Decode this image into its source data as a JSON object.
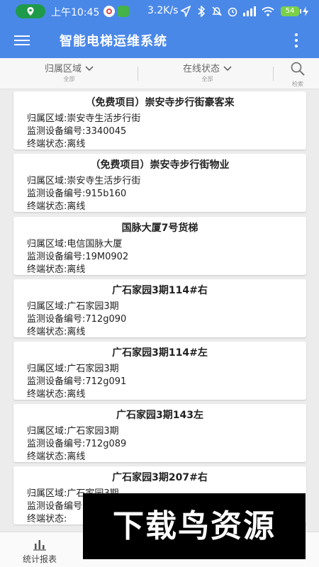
{
  "status_bar": {
    "time": "上午10:45",
    "net_speed": "3.2K/s",
    "battery": "54"
  },
  "app": {
    "title": "智能电梯运维系统"
  },
  "filters": [
    {
      "label": "归属区域",
      "sub": "全部"
    },
    {
      "label": "在线状态",
      "sub": "全部"
    }
  ],
  "search": {
    "sub": "检索"
  },
  "cards": [
    {
      "title": "（免费项目）崇安寺步行街豪客来",
      "area": "归属区域:崇安寺生活步行街",
      "device": "监测设备编号:3340045",
      "status": "终端状态:离线"
    },
    {
      "title": "（免费项目）崇安寺步行街物业",
      "area": "归属区域:崇安寺生活步行街",
      "device": "监测设备编号:915b160",
      "status": "终端状态:离线"
    },
    {
      "title": "国脉大厦7号货梯",
      "area": "归属区域:电信国脉大厦",
      "device": "监测设备编号:19M0902",
      "status": "终端状态:离线"
    },
    {
      "title": "广石家园3期114#右",
      "area": "归属区域:广石家园3期",
      "device": "监测设备编号:712g090",
      "status": "终端状态:离线"
    },
    {
      "title": "广石家园3期114#左",
      "area": "归属区域:广石家园3期",
      "device": "监测设备编号:712g091",
      "status": "终端状态:离线"
    },
    {
      "title": "广石家园3期143左",
      "area": "归属区域:广石家园3期",
      "device": "监测设备编号:712g089",
      "status": "终端状态:离线"
    },
    {
      "title": "广石家园3期207#右",
      "area": "归属区域:广石家园3期",
      "device": "监测设备编号:",
      "status": "终端状态:"
    }
  ],
  "bottom_nav": [
    {
      "label": "统计报表",
      "icon": "bar-chart-icon"
    }
  ],
  "watermark": "下载鸟资源",
  "colors": {
    "primary": "#4a88e8",
    "background": "#ececec",
    "card": "#ffffff"
  }
}
